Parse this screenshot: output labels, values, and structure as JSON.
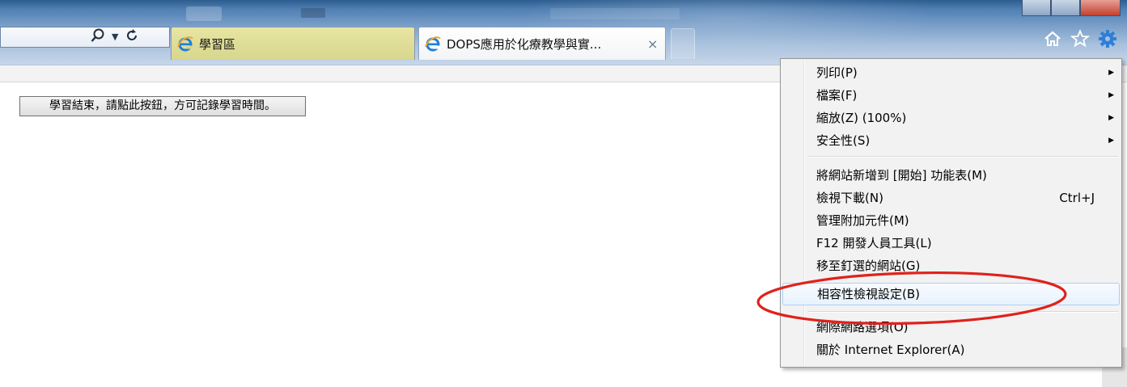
{
  "toolbar": {
    "search_icon": "magnifier-icon",
    "dropdown_icon": "chevron-down-icon",
    "refresh_icon": "refresh-icon"
  },
  "tabs": [
    {
      "title": "學習區",
      "icon": "ie-logo-icon",
      "active": false
    },
    {
      "title": "DOPS應用於化療教學與實...",
      "icon": "ie-logo-icon",
      "active": true,
      "close": "×"
    }
  ],
  "right_icons": [
    "home-icon",
    "favorites-star-icon",
    "tools-gear-icon"
  ],
  "page": {
    "finish_button": "學習結束，請點此按鈕，方可記錄學習時間。"
  },
  "menu": {
    "items": [
      {
        "label": "列印(P)",
        "submenu": true
      },
      {
        "label": "檔案(F)",
        "submenu": true
      },
      {
        "label": "縮放(Z) (100%)",
        "submenu": true
      },
      {
        "label": "安全性(S)",
        "submenu": true
      },
      {
        "label": "將網站新增到 [開始] 功能表(M)"
      },
      {
        "label": "檢視下載(N)",
        "shortcut": "Ctrl+J"
      },
      {
        "label": "管理附加元件(M)"
      },
      {
        "label": "F12 開發人員工具(L)"
      },
      {
        "label": "移至釘選的網站(G)"
      },
      {
        "label": "相容性檢視設定(B)",
        "highlighted": true
      },
      {
        "label": "網際網路選項(O)"
      },
      {
        "label": "關於 Internet Explorer(A)"
      }
    ],
    "submenu_arrow": "▶"
  },
  "colors": {
    "annotation": "#e0211c",
    "tab_inactive": "#e2e19a",
    "menu_highlight": "#e8f2fd"
  }
}
